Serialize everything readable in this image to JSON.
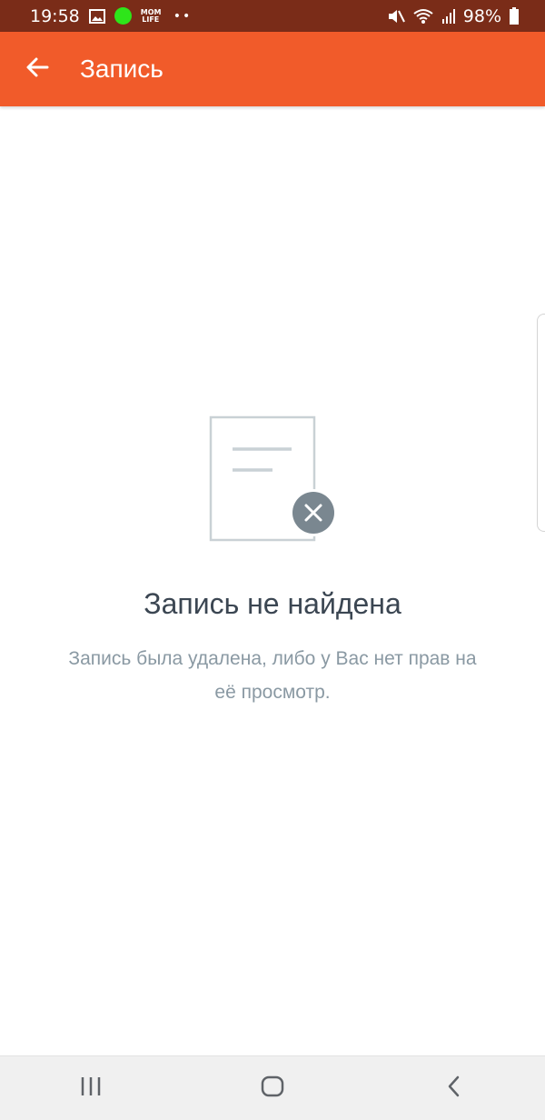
{
  "status_bar": {
    "time": "19:58",
    "app_badge": "MOM LIFE",
    "battery": "98%"
  },
  "app_bar": {
    "title": "Запись"
  },
  "empty_state": {
    "title": "Запись не найдена",
    "description": "Запись была удалена, либо у Вас нет прав на её просмотр."
  },
  "icons": {
    "back": "arrow-left-icon",
    "empty": "document-removed-icon",
    "nav_recents": "recents-icon",
    "nav_home": "home-icon",
    "nav_back": "back-chevron-icon"
  },
  "colors": {
    "app_bar": "#f15b2a",
    "status_bar": "#7a2c18",
    "title_text": "#3b4652",
    "desc_text": "#8a99a3"
  }
}
